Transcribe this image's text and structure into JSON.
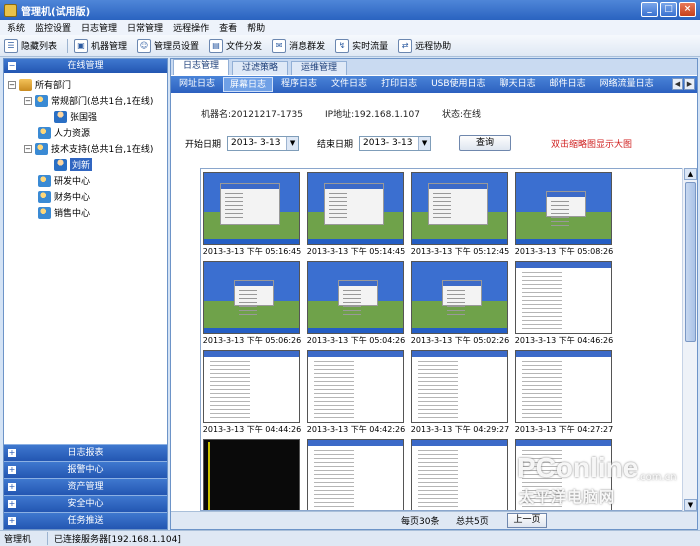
{
  "window": {
    "title": "管理机(试用版)",
    "buttons": [
      "minimize",
      "maximize",
      "close"
    ]
  },
  "menu": [
    "系统",
    "监控设置",
    "日志管理",
    "日常管理",
    "远程操作",
    "查看",
    "帮助"
  ],
  "toolbar": {
    "items": [
      {
        "label": "隐藏列表",
        "icon": "list-icon"
      },
      {
        "label": "机器管理",
        "icon": "computer-icon"
      },
      {
        "label": "管理员设置",
        "icon": "admin-icon"
      },
      {
        "label": "文件分发",
        "icon": "file-icon"
      },
      {
        "label": "消息群发",
        "icon": "message-icon"
      },
      {
        "label": "实时流量",
        "icon": "traffic-icon"
      },
      {
        "label": "远程协助",
        "icon": "remote-icon"
      }
    ]
  },
  "sidebar": {
    "header": "在线管理",
    "tree": {
      "root": "所有部门",
      "dept1": "常规部门(总共1台,1在线)",
      "user1": "张国强",
      "dept2": "人力资源",
      "dept3": "技术支持(总共1台,1在线)",
      "user2": "刘新",
      "dept4": "研发中心",
      "dept5": "财务中心",
      "dept6": "销售中心"
    },
    "sections": [
      "日志报表",
      "报警中心",
      "资产管理",
      "安全中心",
      "任务推送"
    ]
  },
  "main": {
    "tabs": [
      "日志管理",
      "过滤策略",
      "运维管理"
    ],
    "log_tabs": [
      "网址日志",
      "屏幕日志",
      "程序日志",
      "文件日志",
      "打印日志",
      "USB使用日志",
      "聊天日志",
      "邮件日志",
      "网络流量日志"
    ],
    "info": {
      "machine": "机器名:20121217-1735",
      "ip": "IP地址:192.168.1.107",
      "status": "状态:在线"
    },
    "filter": {
      "start_label": "开始日期",
      "start_value": "2013- 3-13",
      "end_label": "结束日期",
      "end_value": "2013- 3-13",
      "query_label": "查询",
      "hint": "双击缩略图显示大图"
    },
    "screenshots": [
      {
        "caption": "2013-3-13 下午 05:16:45",
        "kind": "desk"
      },
      {
        "caption": "2013-3-13 下午 05:14:45",
        "kind": "desk"
      },
      {
        "caption": "2013-3-13 下午 05:12:45",
        "kind": "desk"
      },
      {
        "caption": "2013-3-13 下午 05:08:26",
        "kind": "desk plain"
      },
      {
        "caption": "2013-3-13 下午 05:06:26",
        "kind": "desk plain"
      },
      {
        "caption": "2013-3-13 下午 05:04:26",
        "kind": "desk plain"
      },
      {
        "caption": "2013-3-13 下午 05:02:26",
        "kind": "desk plain"
      },
      {
        "caption": "2013-3-13 下午 04:46:26",
        "kind": "doc"
      },
      {
        "caption": "2013-3-13 下午 04:44:26",
        "kind": "doc"
      },
      {
        "caption": "2013-3-13 下午 04:42:26",
        "kind": "doc"
      },
      {
        "caption": "2013-3-13 下午 04:29:27",
        "kind": "doc"
      },
      {
        "caption": "2013-3-13 下午 04:27:27",
        "kind": "doc"
      },
      {
        "caption": "",
        "kind": "dark"
      },
      {
        "caption": "",
        "kind": "doc"
      },
      {
        "caption": "",
        "kind": "doc"
      },
      {
        "caption": "",
        "kind": "doc"
      }
    ],
    "pager": {
      "per_page": "每页30条",
      "total_pages": "总共5页",
      "next_label": "上一页"
    }
  },
  "status": {
    "app": "管理机",
    "connection": "已连接服务器[192.168.1.104]"
  },
  "watermark": {
    "brand": "PConline",
    "domain": ".com.cn",
    "sub": "太平洋电脑网"
  },
  "colors": {
    "accent": "#2c60bf",
    "hint": "#d02020",
    "selected": "#3166c1"
  }
}
